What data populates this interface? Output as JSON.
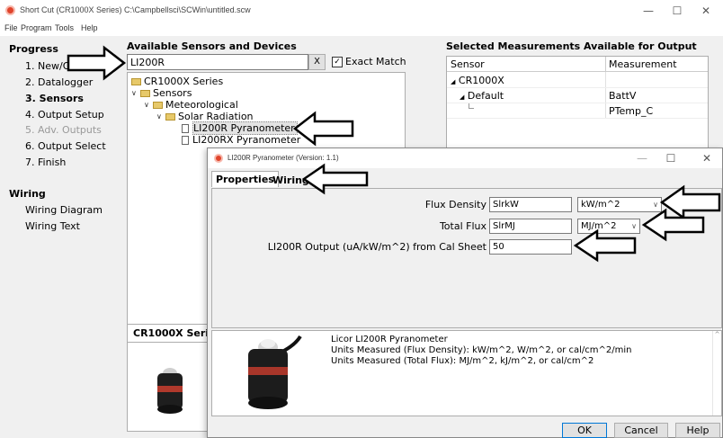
{
  "window": {
    "title": "Short Cut (CR1000X Series) C:\\Campbellsci\\SCWin\\untitled.scw",
    "minimize": "—",
    "maximize": "☐",
    "close": "✕"
  },
  "menu": [
    "File",
    "Program",
    "Tools",
    "Help"
  ],
  "progress": {
    "heading": "Progress",
    "steps": [
      "1. New/Open",
      "2. Datalogger",
      "3. Sensors",
      "4. Output Setup",
      "5. Adv. Outputs",
      "6. Output Select",
      "7. Finish"
    ]
  },
  "wiring": {
    "heading": "Wiring",
    "items": [
      "Wiring Diagram",
      "Wiring Text"
    ]
  },
  "sensors_panel": {
    "heading": "Available Sensors and Devices",
    "search_value": "LI200R",
    "clear_label": "X",
    "exact_match_label": "Exact Match",
    "exact_match_checked": "✓",
    "tree": [
      "CR1000X Series",
      "Sensors",
      "Meteorological",
      "Solar Radiation",
      "LI200R Pyranometer",
      "LI200RX Pyranometer"
    ],
    "bottom_tab": "CR1000X Series"
  },
  "measurements_panel": {
    "heading": "Selected Measurements Available for Output",
    "columns": [
      "Sensor",
      "Measurement"
    ],
    "rows": [
      {
        "sensor": "CR1000X",
        "measurement": ""
      },
      {
        "sensor": "Default",
        "measurement": "BattV"
      },
      {
        "sensor": "",
        "measurement": "PTemp_C"
      }
    ]
  },
  "dialog": {
    "title": "LI200R Pyranometer (Version: 1.1)",
    "minimize": "—",
    "maximize": "☐",
    "close": "✕",
    "tabs": [
      "Properties",
      "Wiring"
    ],
    "fields": {
      "flux_density_label": "Flux Density",
      "flux_density_value": "SlrkW",
      "flux_density_unit": "kW/m^2",
      "total_flux_label": "Total Flux",
      "total_flux_value": "SlrMJ",
      "total_flux_unit": "MJ/m^2",
      "cal_label": "LI200R Output (uA/kW/m^2) from Cal Sheet",
      "cal_value": "50"
    },
    "description": "Licor LI200R Pyranometer\nUnits Measured (Flux Density): kW/m^2, W/m^2, or cal/cm^2/min\nUnits Measured (Total Flux): MJ/m^2, kJ/m^2, or cal/cm^2",
    "buttons": {
      "ok": "OK",
      "cancel": "Cancel",
      "help": "Help"
    }
  },
  "colors": {
    "accent": "#0078d7",
    "app_icon": "#e0442c",
    "folder": "#e7c96a"
  }
}
